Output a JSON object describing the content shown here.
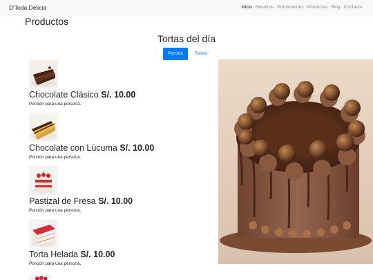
{
  "navbar": {
    "brand": "D'Toda Delicia",
    "links": [
      "Inicio",
      "Nosotros",
      "Promociones",
      "Productos",
      "Blog",
      "Contacto"
    ],
    "active_link": "Inicio"
  },
  "page": {
    "title": "Productos"
  },
  "section": {
    "title": "Tortas del día",
    "tabs": [
      "Porción",
      "Tortas"
    ],
    "active_tab": "Porción"
  },
  "products": [
    {
      "name": "Chocolate Clásico",
      "price": "S/. 10.00",
      "description": "Porción para una persona.",
      "image": "chocolate-cake-slice"
    },
    {
      "name": "Chocolate con Lúcuma",
      "price": "S/. 10.00",
      "description": "Porción para una persona.",
      "image": "lucuma-cake-slice"
    },
    {
      "name": "Pastizal de Fresa",
      "price": "S/. 10.00",
      "description": "Porción para una persona.",
      "image": "strawberry-cake-slice"
    },
    {
      "name": "Torta Helada",
      "price": "S/. 10.00",
      "description": "Porción para una persona.",
      "image": "frozen-cake-slice"
    }
  ],
  "hero_image": "chocolate-ferrero-cake-photo"
}
